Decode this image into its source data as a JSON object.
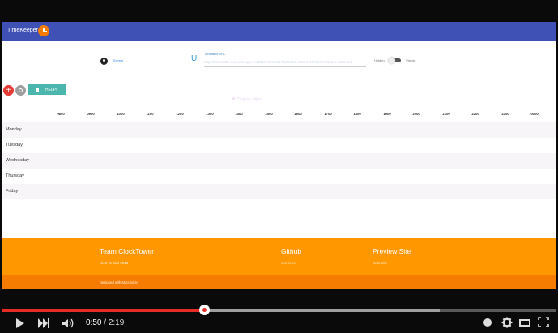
{
  "app": {
    "title": "TimeKeeper"
  },
  "form": {
    "name_placeholder": "Name",
    "url_label": "Timetable URL",
    "url_value": "https://timetable.nus.edu.sg/view/2016-2017/S1?CS1010=LEC:1,TUT:2;MA1101R=LEC:SL1",
    "toggle_off_label": "Hidden",
    "toggle_on_label": "Visible"
  },
  "actions": {
    "add": "+",
    "help": "HELP!"
  },
  "ghost_text": "Drag to adjust",
  "schedule": {
    "hours": [
      "0800",
      "0900",
      "1000",
      "1100",
      "1200",
      "1300",
      "1400",
      "1500",
      "1600",
      "1700",
      "1800",
      "1900",
      "2000",
      "2100",
      "2200",
      "2300",
      "0000"
    ],
    "days": [
      "Monday",
      "Tuesday",
      "Wednesday",
      "Thursday",
      "Friday"
    ]
  },
  "footer": {
    "team_title": "Team ClockTower",
    "team_subtitle": "NUS Orbital 2013",
    "github_title": "Github",
    "github_link": "Our repo",
    "preview_title": "Preview Site",
    "preview_link": "Beta Site",
    "designed_prefix": "Designed with",
    "designed_link": "Materialize"
  },
  "player": {
    "current_time": "0:50",
    "separator": " / ",
    "duration": "2:19",
    "played_fraction": 0.36,
    "buffered_fraction": 0.79
  },
  "colors": {
    "header": "#3f51b5",
    "footer": "#ff9800",
    "accent_red": "#e52d27"
  }
}
